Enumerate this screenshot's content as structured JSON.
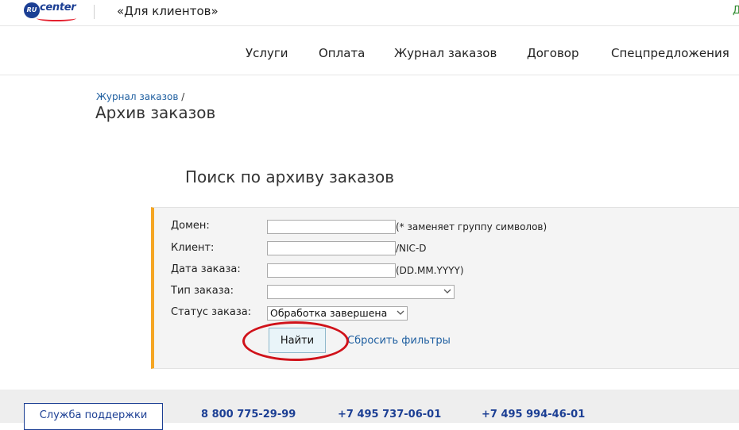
{
  "header": {
    "logo_badge": "RU",
    "logo_word": "center",
    "client_link": "«Для клиентов»",
    "right_fragment": "Д"
  },
  "nav": {
    "items": [
      {
        "label": "Услуги"
      },
      {
        "label": "Оплата"
      },
      {
        "label": "Журнал заказов"
      },
      {
        "label": "Договор"
      },
      {
        "label": "Спецпредложения"
      }
    ]
  },
  "breadcrumb": {
    "link": "Журнал заказов",
    "separator": " /"
  },
  "page_title": "Архив заказов",
  "section_title": "Поиск по архиву заказов",
  "form": {
    "domain": {
      "label": "Домен:",
      "value": "",
      "hint": "(* заменяет группу символов)"
    },
    "client": {
      "label": "Клиент:",
      "value": "",
      "hint": "/NIC-D"
    },
    "order_date": {
      "label": "Дата заказа:",
      "value": "",
      "hint": "(DD.MM.YYYY)"
    },
    "order_type": {
      "label": "Тип заказа:",
      "selected": ""
    },
    "order_status": {
      "label": "Статус заказа:",
      "selected": "Обработка завершена"
    },
    "find_button": "Найти",
    "reset_link": "Сбросить фильтры"
  },
  "footer": {
    "support_button": "Служба поддержки",
    "phones": [
      "8 800 775-29-99",
      "+7 495 737-06-01",
      "+7 495 994-46-01"
    ]
  },
  "colors": {
    "brand_blue": "#1c3f94",
    "accent_orange": "#f5a623",
    "highlight_red": "#d0121a",
    "link_blue": "#1f5fa0"
  }
}
